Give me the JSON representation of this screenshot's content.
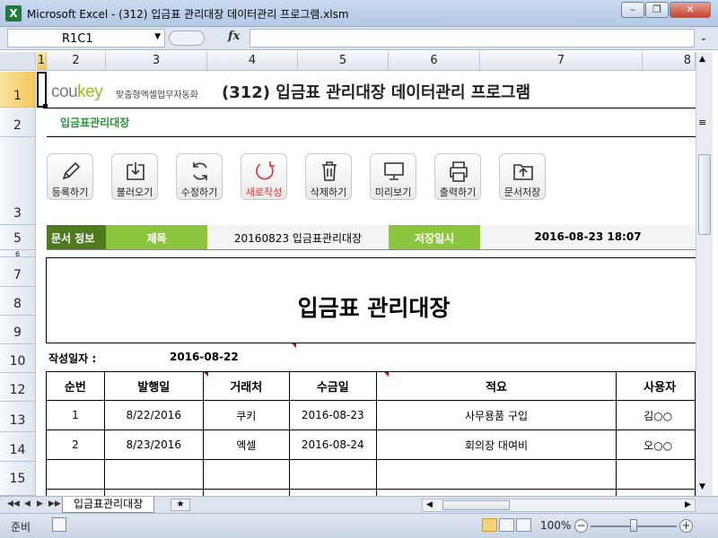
{
  "window": {
    "title": "Microsoft Excel - (312) 입금표 관리대장 데이터관리 프로그램.xlsm",
    "app_icon": "X",
    "controls": [
      "minimize",
      "restore",
      "close"
    ]
  },
  "formula_bar": {
    "name_box": "R1C1",
    "fx_label": "fx",
    "formula": ""
  },
  "columns": [
    "1",
    "2",
    "3",
    "4",
    "5",
    "6",
    "7",
    "8"
  ],
  "rows": [
    "1",
    "2",
    "3",
    "5",
    "6",
    "7",
    "8",
    "9",
    "10",
    "12",
    "13",
    "14",
    "15"
  ],
  "header": {
    "brand_prefix": "cou",
    "brand_suffix": "key",
    "tagline": "맞춤형엑셀업무자동화",
    "app_title": "(312) 입금표 관리대장 데이터관리 프로그램",
    "subtitle": "입금표관리대장"
  },
  "toolbar": [
    {
      "label": "등록하기",
      "icon": "pencil-icon"
    },
    {
      "label": "불러오기",
      "icon": "download-icon"
    },
    {
      "label": "수정하기",
      "icon": "refresh-icon"
    },
    {
      "label": "새로작성",
      "icon": "new-doc-icon",
      "color": "#e03030"
    },
    {
      "label": "삭제하기",
      "icon": "trash-icon"
    },
    {
      "label": "미리보기",
      "icon": "monitor-icon"
    },
    {
      "label": "출력하기",
      "icon": "printer-icon"
    },
    {
      "label": "문서저장",
      "icon": "folder-upload-icon"
    }
  ],
  "info": {
    "doc_info_label": "문서 정보",
    "title_label": "제목",
    "title_value": "20160823 입금표관리대장",
    "saved_label": "저장일시",
    "saved_value": "2016-08-23 18:07"
  },
  "document": {
    "heading": "입금표 관리대장",
    "date_label": "작성일자 :",
    "date_value": "2016-08-22"
  },
  "table": {
    "headers": [
      "순번",
      "발행일",
      "거래처",
      "수금일",
      "적요",
      "사용자"
    ],
    "rows": [
      [
        "1",
        "8/22/2016",
        "쿠키",
        "2016-08-23",
        "사무용품 구입",
        "김○○"
      ],
      [
        "2",
        "8/23/2016",
        "엑셀",
        "2016-08-24",
        "회의장 대여비",
        "오○○"
      ],
      [
        "",
        "",
        "",
        "",
        "",
        ""
      ]
    ]
  },
  "sheet_tabs": {
    "active": "입금표관리대장"
  },
  "status": {
    "mode": "준비",
    "zoom": "100%",
    "zoom_minus": "−",
    "zoom_plus": "+"
  },
  "colors": {
    "brand_green": "#8cbf26",
    "info_dark_green": "#4f7a1f",
    "info_light_green": "#8cc63f",
    "subtitle_green": "#2f8f3a",
    "accent_red": "#e03030"
  }
}
